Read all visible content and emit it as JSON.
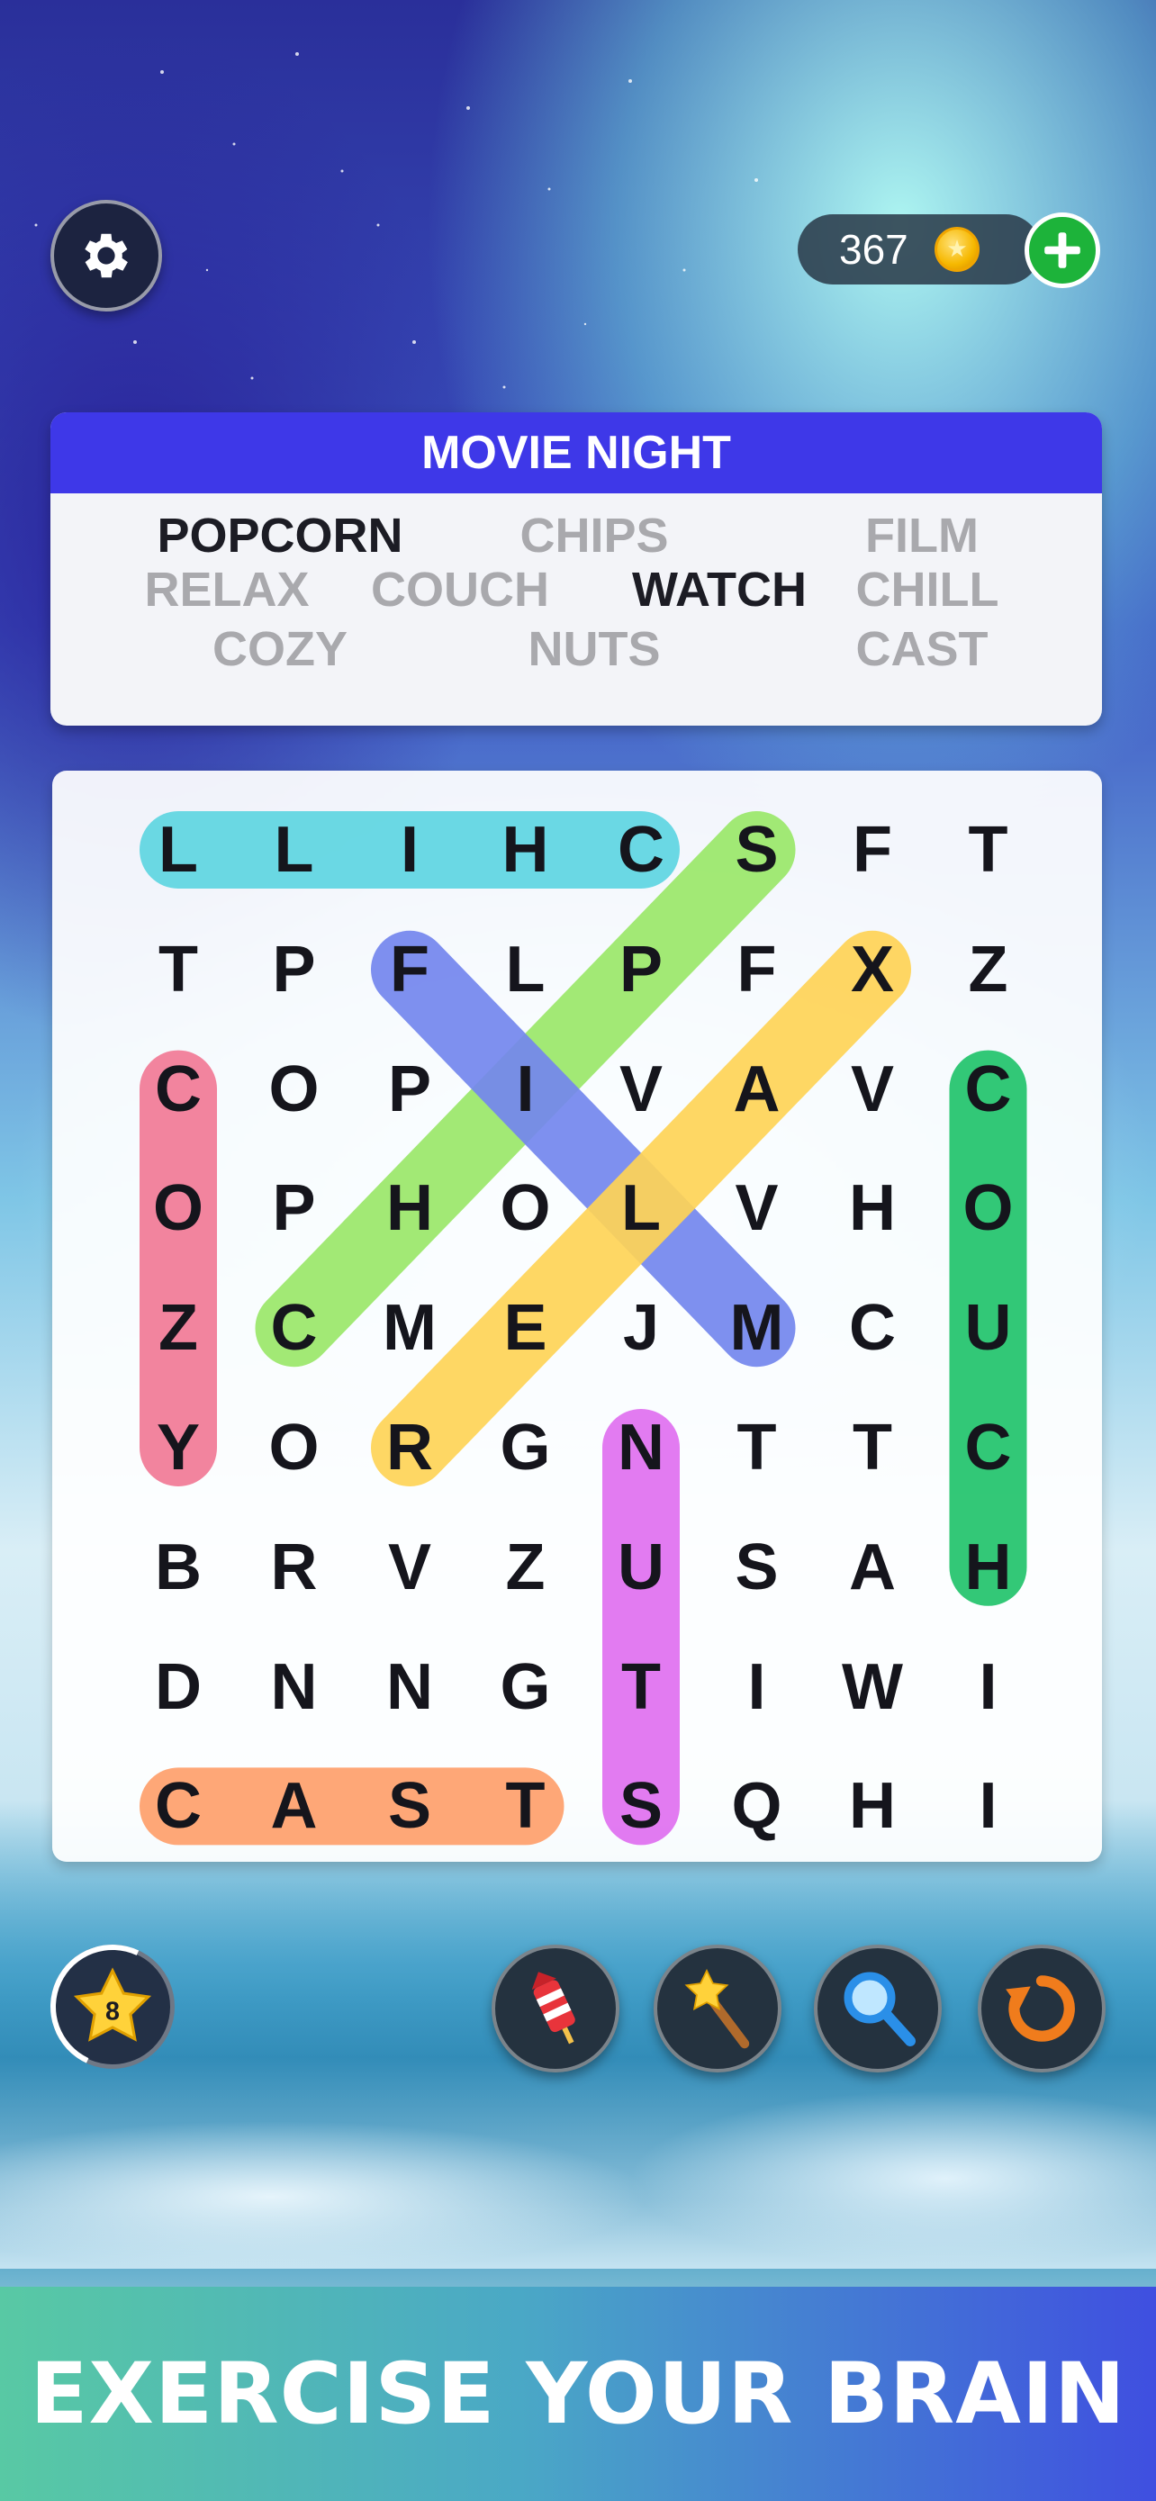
{
  "header": {
    "coins": "367"
  },
  "puzzle": {
    "title": "MOVIE NIGHT",
    "words": [
      {
        "text": "POPCORN",
        "found": true
      },
      {
        "text": "CHIPS",
        "found": false
      },
      {
        "text": "FILM",
        "found": false
      },
      {
        "text": "RELAX",
        "found": false
      },
      {
        "text": "COUCH",
        "found": false
      },
      {
        "text": "WATCH",
        "found": true
      },
      {
        "text": "CHILL",
        "found": false
      },
      {
        "text": "COZY",
        "found": false
      },
      {
        "text": "NUTS",
        "found": false
      },
      {
        "text": "CAST",
        "found": false
      }
    ]
  },
  "grid": {
    "rows": [
      [
        "L",
        "L",
        "I",
        "H",
        "C",
        "S",
        "F",
        "T"
      ],
      [
        "T",
        "P",
        "F",
        "L",
        "P",
        "F",
        "X",
        "Z"
      ],
      [
        "C",
        "O",
        "P",
        "I",
        "V",
        "A",
        "V",
        "C"
      ],
      [
        "O",
        "P",
        "H",
        "O",
        "L",
        "V",
        "H",
        "O"
      ],
      [
        "Z",
        "C",
        "M",
        "E",
        "J",
        "M",
        "C",
        "U"
      ],
      [
        "Y",
        "O",
        "R",
        "G",
        "N",
        "T",
        "T",
        "C"
      ],
      [
        "B",
        "R",
        "V",
        "Z",
        "U",
        "S",
        "A",
        "H"
      ],
      [
        "D",
        "N",
        "N",
        "G",
        "T",
        "I",
        "W",
        "I"
      ],
      [
        "C",
        "A",
        "S",
        "T",
        "S",
        "Q",
        "H",
        "I"
      ]
    ],
    "highlights": [
      {
        "word": "CHILL",
        "from": [
          0,
          4
        ],
        "to": [
          0,
          0
        ],
        "color": "#5fd6e2"
      },
      {
        "word": "CHIPS",
        "from": [
          4,
          1
        ],
        "to": [
          0,
          5
        ],
        "color": "#9be86a"
      },
      {
        "word": "FILM",
        "from": [
          1,
          2
        ],
        "to": [
          4,
          5
        ],
        "color": "#7487ee"
      },
      {
        "word": "RELAX",
        "from": [
          5,
          2
        ],
        "to": [
          1,
          6
        ],
        "color": "#ffd457"
      },
      {
        "word": "COZY",
        "from": [
          2,
          0
        ],
        "to": [
          5,
          0
        ],
        "color": "#f27a96"
      },
      {
        "word": "COUCH",
        "from": [
          2,
          7
        ],
        "to": [
          6,
          7
        ],
        "color": "#22c46c"
      },
      {
        "word": "NUTS",
        "from": [
          5,
          4
        ],
        "to": [
          8,
          4
        ],
        "color": "#e070f0"
      },
      {
        "word": "CAST",
        "from": [
          8,
          0
        ],
        "to": [
          8,
          3
        ],
        "color": "#ffa06c"
      }
    ]
  },
  "tools": {
    "level": "8",
    "items": [
      {
        "name": "firework-hint",
        "icon": "firework-icon"
      },
      {
        "name": "magic-wand-hint",
        "icon": "magic-wand-icon"
      },
      {
        "name": "magnifier-hint",
        "icon": "magnifier-icon"
      },
      {
        "name": "shuffle",
        "icon": "rotate-icon"
      }
    ]
  },
  "banner": {
    "text": "EXERCISE YOUR BRAIN"
  }
}
